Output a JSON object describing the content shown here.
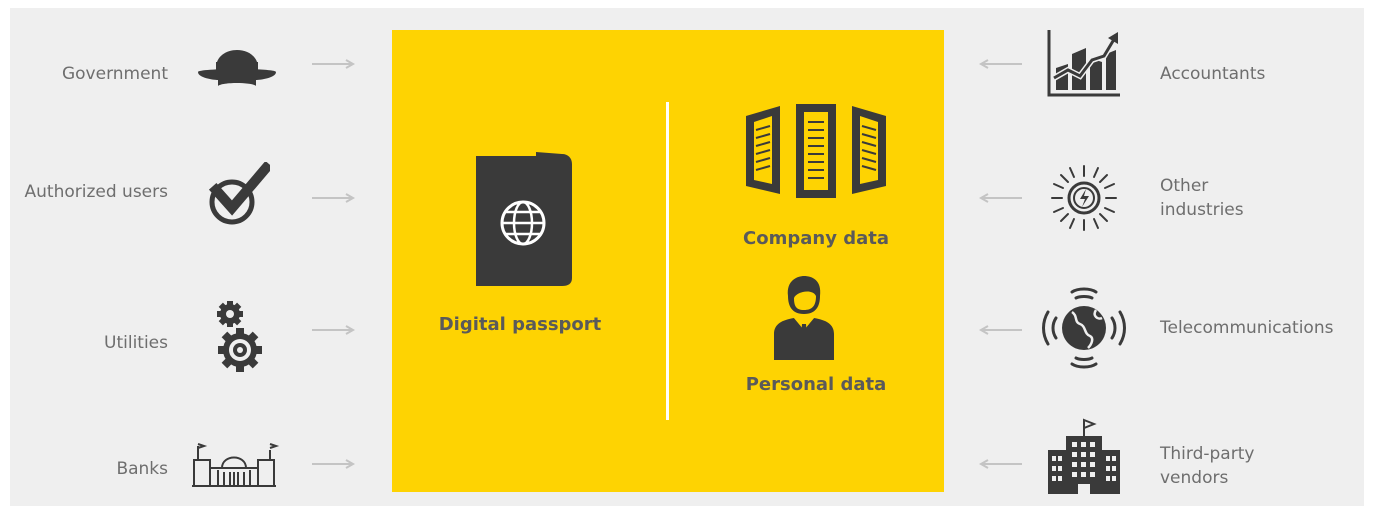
{
  "colors": {
    "accent_yellow": "#fed302",
    "icon_dark": "#3a3a3a",
    "panel_bg": "#efefef",
    "label_gray": "#6e6e6e",
    "arrow_gray": "#c4c4c4"
  },
  "left_items": [
    {
      "label": "Government",
      "icon": "bowler-hat-icon"
    },
    {
      "label": "Authorized users",
      "icon": "checkmark-icon"
    },
    {
      "label": "Utilities",
      "icon": "gears-icon"
    },
    {
      "label": "Banks",
      "icon": "bank-building-icon"
    }
  ],
  "right_items": [
    {
      "label": "Accountants",
      "icon": "chart-icon"
    },
    {
      "label": "Other industries",
      "icon": "energy-sun-icon"
    },
    {
      "label": "Telecommunications",
      "icon": "globe-signal-icon"
    },
    {
      "label": "Third-party vendors",
      "icon": "office-building-icon"
    }
  ],
  "center": {
    "passport_label": "Digital passport",
    "company_label": "Company data",
    "personal_label": "Personal data"
  }
}
